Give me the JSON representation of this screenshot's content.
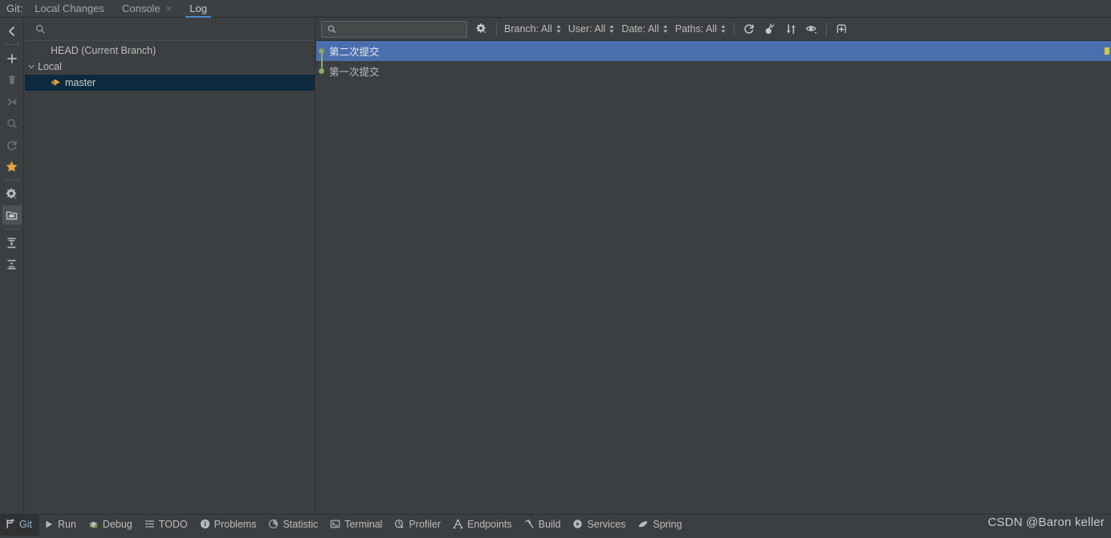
{
  "window": {
    "theme_background": "#3c3f41",
    "accent_color": "#4a88c7",
    "selection_color": "#4b6eaf",
    "tree_selection_color": "#0d293e"
  },
  "tabbar": {
    "label": "Git:",
    "tabs": [
      {
        "label": "Local Changes",
        "active": false,
        "closable": false
      },
      {
        "label": "Console",
        "active": false,
        "closable": true,
        "close_glyph": "×"
      },
      {
        "label": "Log",
        "active": true,
        "closable": false
      }
    ]
  },
  "rail": {
    "items": [
      {
        "name": "collapse-panel-icon",
        "title": "Hide",
        "state": "normal"
      },
      {
        "name": "add-icon",
        "title": "Add",
        "state": "normal"
      },
      {
        "name": "delete-icon",
        "title": "Delete",
        "state": "disabled"
      },
      {
        "name": "merge-icon",
        "title": "Merge",
        "state": "disabled"
      },
      {
        "name": "search-icon",
        "title": "Search",
        "state": "disabled"
      },
      {
        "name": "refresh-icon",
        "title": "Refresh",
        "state": "disabled"
      },
      {
        "name": "favorite-star-icon",
        "title": "Favorite",
        "state": "highlighted",
        "color": "#e8a33d"
      },
      {
        "name": "settings-gear-icon",
        "title": "Settings",
        "state": "normal"
      },
      {
        "name": "folder-icon",
        "title": "Group by directory",
        "state": "selected"
      },
      {
        "name": "expand-all-icon",
        "title": "Expand All",
        "state": "normal"
      },
      {
        "name": "collapse-all-icon",
        "title": "Collapse All",
        "state": "normal"
      }
    ]
  },
  "branch_panel": {
    "search": {
      "placeholder": "",
      "value": "",
      "icon": "search-icon"
    },
    "tree": [
      {
        "label": "HEAD (Current Branch)",
        "depth": 1,
        "chevron": "",
        "icon": "",
        "selected": false
      },
      {
        "label": "Local",
        "depth": 0,
        "chevron": "⌄",
        "icon": "",
        "selected": false
      },
      {
        "label": "master",
        "depth": 2,
        "chevron": "",
        "icon": "branch-tag-icon",
        "selected": true
      }
    ]
  },
  "log_toolbar": {
    "search": {
      "placeholder": "",
      "value": "",
      "icon": "search-dropdown-icon"
    },
    "settings_icon": "gear-dropdown-icon",
    "filters": [
      {
        "name": "branch-filter",
        "label": "Branch: All"
      },
      {
        "name": "user-filter",
        "label": "User: All"
      },
      {
        "name": "date-filter",
        "label": "Date: All"
      },
      {
        "name": "paths-filter",
        "label": "Paths: All"
      }
    ],
    "actions": [
      {
        "name": "refresh-icon",
        "title": "Refresh"
      },
      {
        "name": "cherry-pick-icon",
        "title": "Cherry-Pick"
      },
      {
        "name": "sort-icon",
        "title": "Intellisort"
      },
      {
        "name": "show-details-eye-icon",
        "title": "Show Details"
      },
      {
        "name": "open-in-new-tab-icon",
        "title": "Open in New Tab"
      }
    ]
  },
  "commit_list": {
    "commits": [
      {
        "message": "第二次提交",
        "selected": true,
        "node_color": "#90ae6b"
      },
      {
        "message": "第一次提交",
        "selected": false,
        "node_color": "#90ae6b"
      }
    ],
    "scroll_marker_color": "#d8c344"
  },
  "statusbar": {
    "items": [
      {
        "label": "Git",
        "icon": "git-branch-icon",
        "active": true
      },
      {
        "label": "Run",
        "icon": "play-icon",
        "active": false
      },
      {
        "label": "Debug",
        "icon": "bug-icon",
        "active": false
      },
      {
        "label": "TODO",
        "icon": "list-icon",
        "active": false
      },
      {
        "label": "Problems",
        "icon": "warning-circle-icon",
        "active": false
      },
      {
        "label": "Statistic",
        "icon": "pie-chart-icon",
        "active": false
      },
      {
        "label": "Terminal",
        "icon": "terminal-icon",
        "active": false
      },
      {
        "label": "Profiler",
        "icon": "profiler-icon",
        "active": false
      },
      {
        "label": "Endpoints",
        "icon": "endpoints-icon",
        "active": false
      },
      {
        "label": "Build",
        "icon": "hammer-icon",
        "active": false
      },
      {
        "label": "Services",
        "icon": "services-play-icon",
        "active": false
      },
      {
        "label": "Spring",
        "icon": "spring-leaf-icon",
        "active": false
      }
    ],
    "watermark": "CSDN @Baron keller"
  }
}
